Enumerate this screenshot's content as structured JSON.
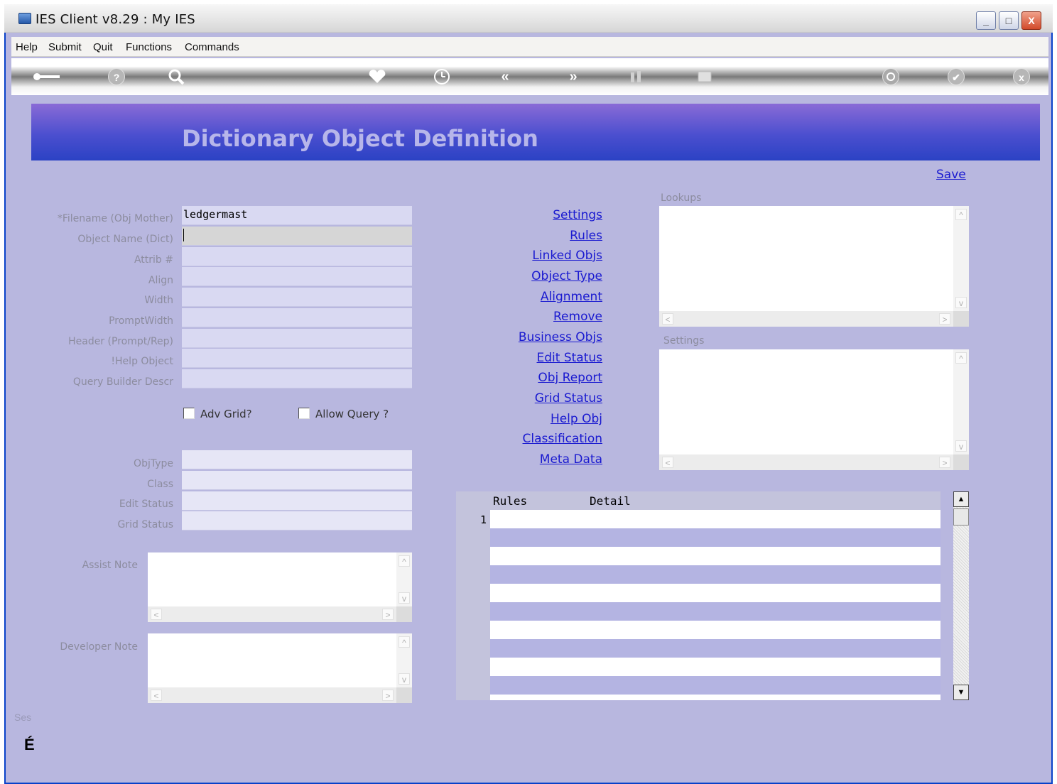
{
  "window": {
    "title": "IES Client v8.29 : My IES",
    "controls": {
      "minimize": "_",
      "maximize": "□",
      "close": "X"
    }
  },
  "menu": [
    "Help",
    "Submit",
    "Quit",
    "Functions",
    "Commands"
  ],
  "toolbar": {
    "icons": [
      "key-icon",
      "help-icon",
      "search-icon",
      "heart-icon",
      "clock-icon",
      "previous-icon",
      "next-icon",
      "tools-icon",
      "grid-icon",
      "recycle-icon",
      "check-icon",
      "close-icon"
    ],
    "glyphs": {
      "previous": "«",
      "next": "»",
      "help": "?",
      "close": "x",
      "check": "✔"
    }
  },
  "page": {
    "heading": "Dictionary Object Definition",
    "save_label": "Save"
  },
  "form": {
    "labels": {
      "filename": "*Filename (Obj Mother)",
      "object_name": "Object Name (Dict)",
      "attrib": "Attrib #",
      "align": "Align",
      "width": "Width",
      "prompt_width": "PromptWidth",
      "header": "Header (Prompt/Rep)",
      "help_object": "!Help Object",
      "query_builder": "Query Builder Descr",
      "objtype": "ObjType",
      "class": "Class",
      "edit_status": "Edit Status",
      "grid_status": "Grid Status",
      "assist_note": "Assist Note",
      "developer_note": "Developer Note"
    },
    "values": {
      "filename": "ledgermast",
      "object_name": "",
      "attrib": "",
      "align": "",
      "width": "",
      "prompt_width": "",
      "header": "",
      "help_object": "",
      "query_builder": "",
      "objtype": "",
      "class": "",
      "edit_status": "",
      "grid_status": ""
    },
    "checkboxes": {
      "adv_grid": "Adv Grid?",
      "allow_query": "Allow Query ?"
    }
  },
  "links": [
    "Settings",
    "Rules",
    "Linked Objs",
    "Object Type",
    "Alignment",
    "Remove",
    "Business Objs",
    "Edit Status",
    "Obj Report",
    "Grid Status",
    "Help Obj",
    "Classification",
    "Meta Data"
  ],
  "panels": {
    "lookups": "Lookups",
    "settings": "Settings"
  },
  "grid": {
    "columns": [
      "Rules",
      "Detail"
    ],
    "first_row_number": "1"
  },
  "footer": {
    "session": "Ses",
    "glyph": "É"
  }
}
